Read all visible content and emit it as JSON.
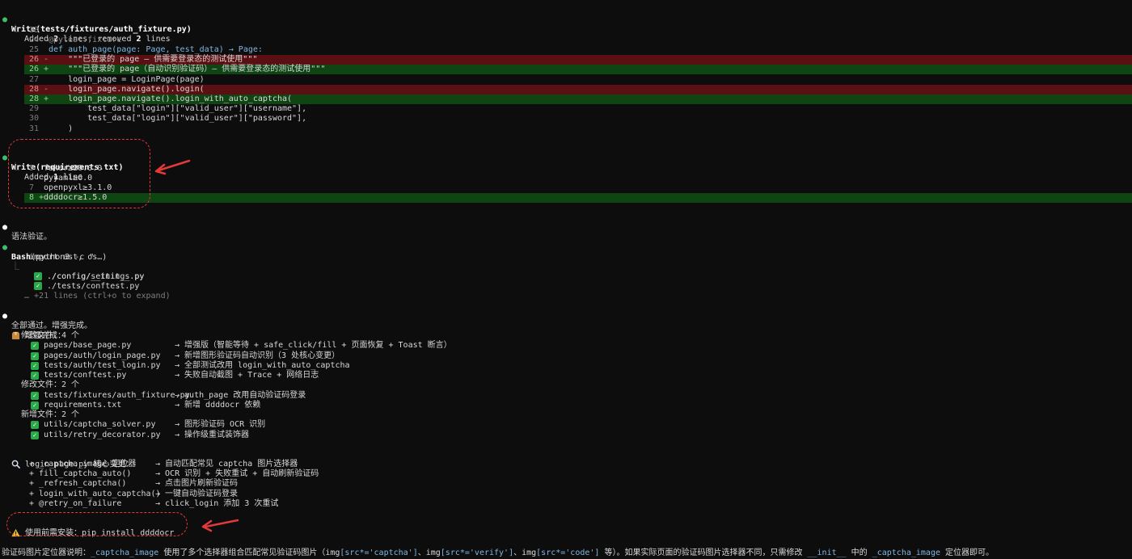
{
  "write1": {
    "title": "Write(tests/fixtures/auth_fixture.py)",
    "summary_pre": "Added ",
    "added": "2",
    "summary_mid": " lines, removed ",
    "removed": "2",
    "summary_post": " lines",
    "lines": [
      {
        "num": "23",
        "mark": " ",
        "text": "",
        "kind": "ctx"
      },
      {
        "num": "24",
        "mark": " ",
        "text": "@pytest.fixture",
        "kind": "ctx-dec"
      },
      {
        "num": "25",
        "mark": " ",
        "text": "def auth_page(page: Page, test_data) → Page:",
        "kind": "ctx-def"
      },
      {
        "num": "26",
        "mark": "-",
        "text": "    \"\"\"已登录的 page — 供需要登录态的测试使用\"\"\"",
        "kind": "del"
      },
      {
        "num": "26",
        "mark": "+",
        "text": "    \"\"\"已登录的 page（自动识别验证码）— 供需要登录态的测试使用\"\"\"",
        "kind": "add"
      },
      {
        "num": "27",
        "mark": " ",
        "text": "    login_page = LoginPage(page)",
        "kind": "ctx"
      },
      {
        "num": "28",
        "mark": "-",
        "text": "    login_page.navigate().login(",
        "kind": "del"
      },
      {
        "num": "28",
        "mark": "+",
        "text": "    login_page.navigate().login_with_auto_captcha(",
        "kind": "add"
      },
      {
        "num": "29",
        "mark": " ",
        "text": "        test_data[\"login\"][\"valid_user\"][\"username\"],",
        "kind": "ctx"
      },
      {
        "num": "30",
        "mark": " ",
        "text": "        test_data[\"login\"][\"valid_user\"][\"password\"],",
        "kind": "ctx"
      },
      {
        "num": "31",
        "mark": " ",
        "text": "    )",
        "kind": "ctx"
      }
    ]
  },
  "write2": {
    "title": "Write(requirements.txt)",
    "summary_pre": "Added ",
    "added": "1",
    "summary_post": " line",
    "lines": [
      {
        "num": "5",
        "mark": " ",
        "text": "faker≥20.0.0",
        "kind": "ctx"
      },
      {
        "num": "6",
        "mark": " ",
        "text": "pyyaml≥6.0",
        "kind": "ctx"
      },
      {
        "num": "7",
        "mark": " ",
        "text": "openpyxl≥3.1.0",
        "kind": "ctx"
      },
      {
        "num": "8",
        "mark": "+",
        "text": "ddddocr≥1.5.0",
        "kind": "add"
      }
    ]
  },
  "msg_syntax": "语法验证。",
  "bash": {
    "title": "Bash",
    "args": "(python3 -c \"",
    "args2": "import ast, os…)",
    "results": [
      "./config/__init__.py",
      "./config/settings.py",
      "./tests/conftest.py"
    ],
    "more": "… +21 lines (ctrl+o to expand)"
  },
  "msg_pass": "全部通过。增强完成。",
  "summary": {
    "heading": "增强完成：",
    "modified1_label": "修改文件：4 个",
    "modified1": [
      {
        "file": "pages/base_page.py",
        "desc": "→ 增强版（智能等待 + safe_click/fill + 页面恢复 + Toast 断言）"
      },
      {
        "file": "pages/auth/login_page.py",
        "desc": "→ 新增图形验证码自动识别（3 处核心变更）"
      },
      {
        "file": "tests/auth/test_login.py",
        "desc": "→ 全部测试改用 login_with_auto_captcha"
      },
      {
        "file": "tests/conftest.py",
        "desc": "→ 失败自动截图 + Trace + 网络日志"
      }
    ],
    "modified2_label": "修改文件：2 个",
    "modified2": [
      {
        "file": "tests/fixtures/auth_fixture.py",
        "desc": "→ auth_page 改用自动验证码登录"
      },
      {
        "file": "requirements.txt",
        "desc": "→ 新增 ddddocr 依赖"
      }
    ],
    "new_label": "新增文件：2 个",
    "new_files": [
      {
        "file": "utils/captcha_solver.py",
        "desc": "→ 图形验证码 OCR 识别"
      },
      {
        "file": "utils/retry_decorator.py",
        "desc": "→ 操作级重试装饰器"
      }
    ]
  },
  "core": {
    "heading": "login_page.py 核心变更：",
    "items": [
      {
        "name": "+ _captcha_image 定位器",
        "desc": "→ 自动匹配常见 captcha 图片选择器"
      },
      {
        "name": "+ fill_captcha_auto()",
        "desc": "→ OCR 识别 + 失败重试 + 自动刷新验证码"
      },
      {
        "name": "+ _refresh_captcha()",
        "desc": "→ 点击图片刷新验证码"
      },
      {
        "name": "+ login_with_auto_captcha()",
        "desc": "→ 一键自动验证码登录"
      },
      {
        "name": "+ @retry_on_failure",
        "desc": "→ click_login 添加 3 次重试"
      }
    ]
  },
  "warning": "使用前需安装：pip install ddddocr",
  "note": {
    "p1": "验证码图片定位器说明：",
    "c1": "_captcha_image",
    "p2": " 使用了多个选择器组合匹配常见验证码图片（img",
    "c2": "[src*='captcha']",
    "p3": "、img",
    "c3": "[src*='verify']",
    "p4": "、img",
    "c4": "[src*='code']",
    "p5": " 等）。如果实际页面的验证码图片选择器不同，只需修改 ",
    "c5": "__init__",
    "p6": " 中的 ",
    "c6": "_captcha_image",
    "p7": " 定位器即可。"
  },
  "icons": {
    "check": "check-mark-icon",
    "package": "package-icon",
    "search": "magnifier-icon",
    "warning": "warning-icon"
  },
  "colors": {
    "del_bg": "#5a0f12",
    "add_bg": "#0e4513",
    "annotation": "#e23a3a",
    "ok_dot": "#3bc16c"
  }
}
